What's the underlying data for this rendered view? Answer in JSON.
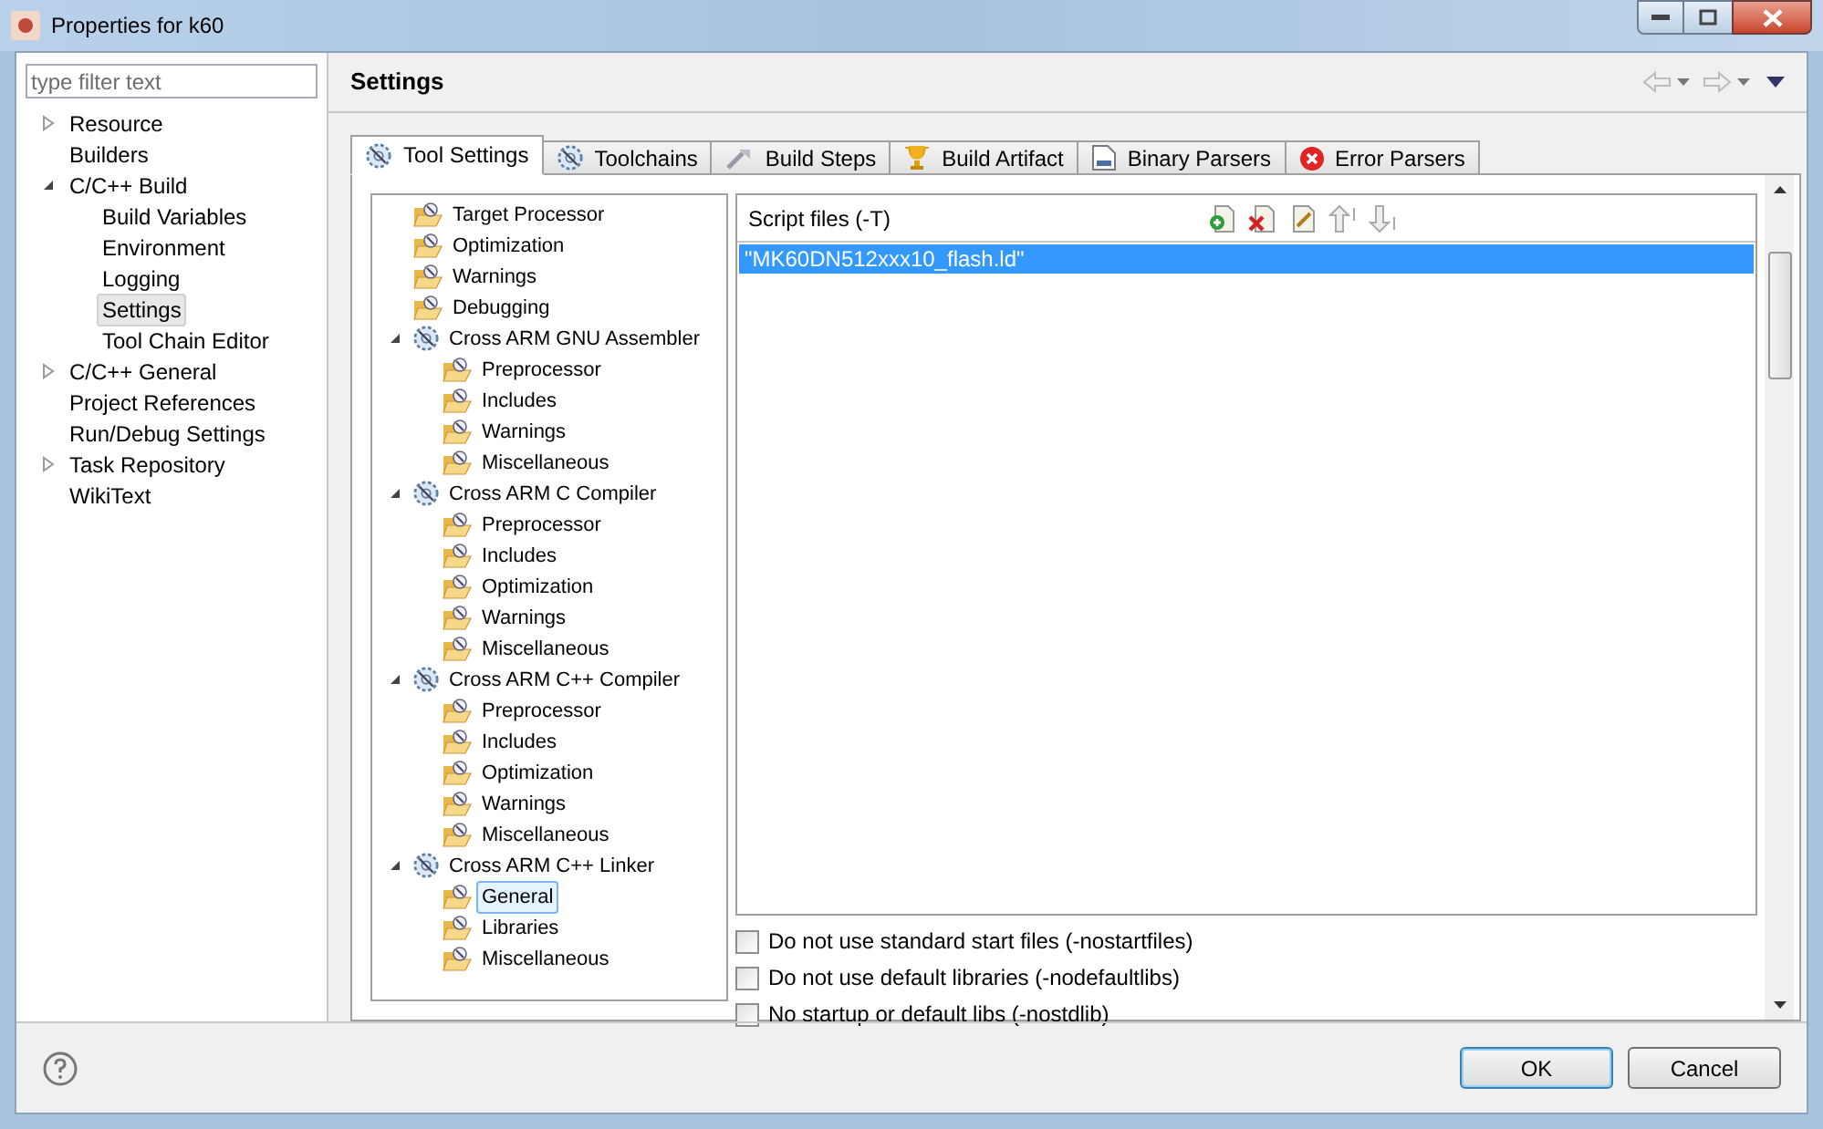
{
  "window": {
    "title": "Properties for k60"
  },
  "filter": {
    "placeholder": "type filter text"
  },
  "nav": [
    {
      "label": "Resource",
      "expanded": false,
      "selected": false
    },
    {
      "label": "Builders",
      "selected": false
    },
    {
      "label": "C/C++ Build",
      "expanded": true,
      "selected": false,
      "children": [
        {
          "label": "Build Variables",
          "selected": false
        },
        {
          "label": "Environment",
          "selected": false
        },
        {
          "label": "Logging",
          "selected": false
        },
        {
          "label": "Settings",
          "selected": true
        },
        {
          "label": "Tool Chain Editor",
          "selected": false
        }
      ]
    },
    {
      "label": "C/C++ General",
      "expanded": false,
      "selected": false
    },
    {
      "label": "Project References",
      "selected": false
    },
    {
      "label": "Run/Debug Settings",
      "selected": false
    },
    {
      "label": "Task Repository",
      "expanded": false,
      "selected": false
    },
    {
      "label": "WikiText",
      "selected": false
    }
  ],
  "page_title": "Settings",
  "tabs": [
    {
      "label": "Tool Settings",
      "kind": "gear",
      "selected": true
    },
    {
      "label": "Toolchains",
      "kind": "gear",
      "selected": false
    },
    {
      "label": "Build Steps",
      "kind": "steps",
      "selected": false
    },
    {
      "label": "Build Artifact",
      "kind": "trophy",
      "selected": false
    },
    {
      "label": "Binary Parsers",
      "kind": "binary",
      "selected": false
    },
    {
      "label": "Error Parsers",
      "kind": "error",
      "selected": false
    }
  ],
  "tool_tree": [
    {
      "label": "Target Processor",
      "kind": "option",
      "selected": false
    },
    {
      "label": "Optimization",
      "kind": "option",
      "selected": false
    },
    {
      "label": "Warnings",
      "kind": "option",
      "selected": false
    },
    {
      "label": "Debugging",
      "kind": "option",
      "selected": false
    },
    {
      "label": "Cross ARM GNU Assembler",
      "kind": "tool",
      "expanded": true,
      "selected": false,
      "children": [
        {
          "label": "Preprocessor",
          "kind": "option",
          "selected": false
        },
        {
          "label": "Includes",
          "kind": "option",
          "selected": false
        },
        {
          "label": "Warnings",
          "kind": "option",
          "selected": false
        },
        {
          "label": "Miscellaneous",
          "kind": "option",
          "selected": false
        }
      ]
    },
    {
      "label": "Cross ARM C Compiler",
      "kind": "tool",
      "expanded": true,
      "selected": false,
      "children": [
        {
          "label": "Preprocessor",
          "kind": "option",
          "selected": false
        },
        {
          "label": "Includes",
          "kind": "option",
          "selected": false
        },
        {
          "label": "Optimization",
          "kind": "option",
          "selected": false
        },
        {
          "label": "Warnings",
          "kind": "option",
          "selected": false
        },
        {
          "label": "Miscellaneous",
          "kind": "option",
          "selected": false
        }
      ]
    },
    {
      "label": "Cross ARM C++ Compiler",
      "kind": "tool",
      "expanded": true,
      "selected": false,
      "children": [
        {
          "label": "Preprocessor",
          "kind": "option",
          "selected": false
        },
        {
          "label": "Includes",
          "kind": "option",
          "selected": false
        },
        {
          "label": "Optimization",
          "kind": "option",
          "selected": false
        },
        {
          "label": "Warnings",
          "kind": "option",
          "selected": false
        },
        {
          "label": "Miscellaneous",
          "kind": "option",
          "selected": false
        }
      ]
    },
    {
      "label": "Cross ARM C++ Linker",
      "kind": "tool",
      "expanded": true,
      "selected": false,
      "children": [
        {
          "label": "General",
          "kind": "option",
          "selected": true
        },
        {
          "label": "Libraries",
          "kind": "option",
          "selected": false
        },
        {
          "label": "Miscellaneous",
          "kind": "option",
          "selected": false
        }
      ]
    }
  ],
  "script_files": {
    "label": "Script files (-T)",
    "items": [
      {
        "text": "\"MK60DN512xxx10_flash.ld\"",
        "selected": true
      }
    ]
  },
  "options": [
    {
      "label": "Do not use standard start files (-nostartfiles)",
      "checked": false
    },
    {
      "label": "Do not use default libraries (-nodefaultlibs)",
      "checked": false
    },
    {
      "label": "No startup or default libs (-nostdlib)",
      "checked": false
    }
  ],
  "buttons": [
    {
      "label": "OK",
      "default": true
    },
    {
      "label": "Cancel",
      "default": false
    }
  ]
}
